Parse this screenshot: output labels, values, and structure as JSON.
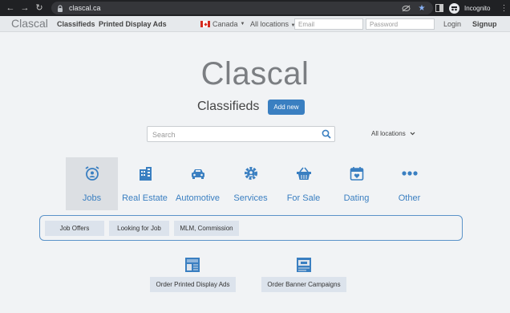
{
  "browser": {
    "url": "clascal.ca",
    "profile_label": "Incognito"
  },
  "site_nav": {
    "logo": "Clascal",
    "links": [
      "Classifieds",
      "Printed Display Ads"
    ],
    "country": "Canada",
    "locations": "All locations",
    "email_placeholder": "Email",
    "password_placeholder": "Password",
    "login": "Login",
    "signup": "Signup"
  },
  "hero": {
    "title": "Clascal",
    "subtitle": "Classifieds",
    "add_new": "Add new"
  },
  "search": {
    "placeholder": "Search",
    "location_select": "All locations"
  },
  "categories": [
    {
      "label": "Jobs",
      "icon": "alarm-user-icon",
      "active": true
    },
    {
      "label": "Real Estate",
      "icon": "buildings-icon",
      "active": false
    },
    {
      "label": "Automotive",
      "icon": "car-icon",
      "active": false
    },
    {
      "label": "Services",
      "icon": "gear-user-icon",
      "active": false
    },
    {
      "label": "For Sale",
      "icon": "basket-icon",
      "active": false
    },
    {
      "label": "Dating",
      "icon": "calendar-heart-icon",
      "active": false
    },
    {
      "label": "Other",
      "icon": "dots-icon",
      "active": false
    }
  ],
  "subcategories": [
    "Job Offers",
    "Looking for Job",
    "MLM, Commission"
  ],
  "actions": {
    "printed_ads": "Order Printed Display Ads",
    "banner_campaigns": "Order Banner Campaigns"
  },
  "colors": {
    "accent": "#3a7fc1",
    "logo_gray": "#7b7e82",
    "background": "#f1f3f5"
  }
}
